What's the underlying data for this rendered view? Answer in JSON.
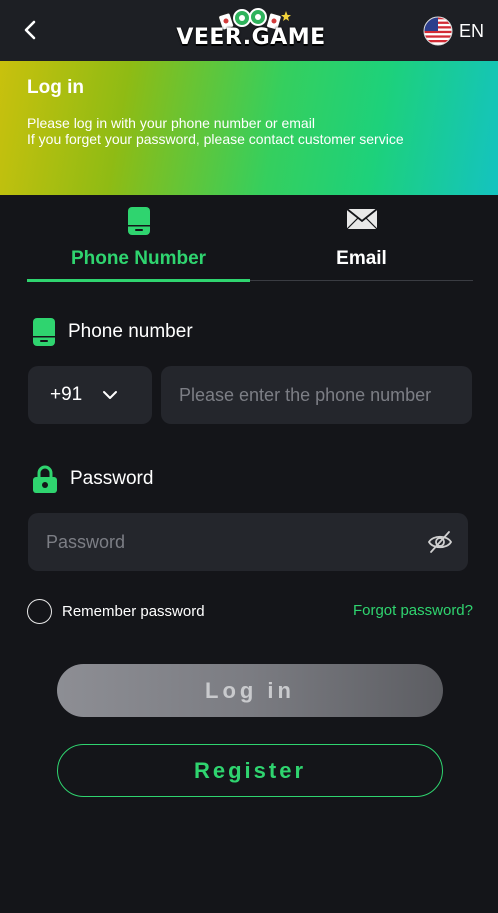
{
  "header": {
    "logo_text": "VEER.GAME",
    "language": "EN",
    "back_icon": "chevron-left-icon",
    "flag_icon": "us-flag-icon"
  },
  "hero": {
    "title": "Log in",
    "line1": "Please log in with your phone number or email",
    "line2": "If you forget your password, please contact customer service"
  },
  "tabs": [
    {
      "label": "Phone Number",
      "icon": "phone-icon",
      "active": true
    },
    {
      "label": "Email",
      "icon": "envelope-icon",
      "active": false
    }
  ],
  "phone_field": {
    "label": "Phone number",
    "country_code": "+91",
    "placeholder": "Please enter the phone number",
    "value": ""
  },
  "password_field": {
    "label": "Password",
    "placeholder": "Password",
    "value": ""
  },
  "remember": {
    "label": "Remember password",
    "checked": false
  },
  "forgot_label": "Forgot password?",
  "login_label": "Log in",
  "register_label": "Register",
  "colors": {
    "accent": "#2fd46f",
    "background": "#141519",
    "input_bg": "#24262c"
  }
}
